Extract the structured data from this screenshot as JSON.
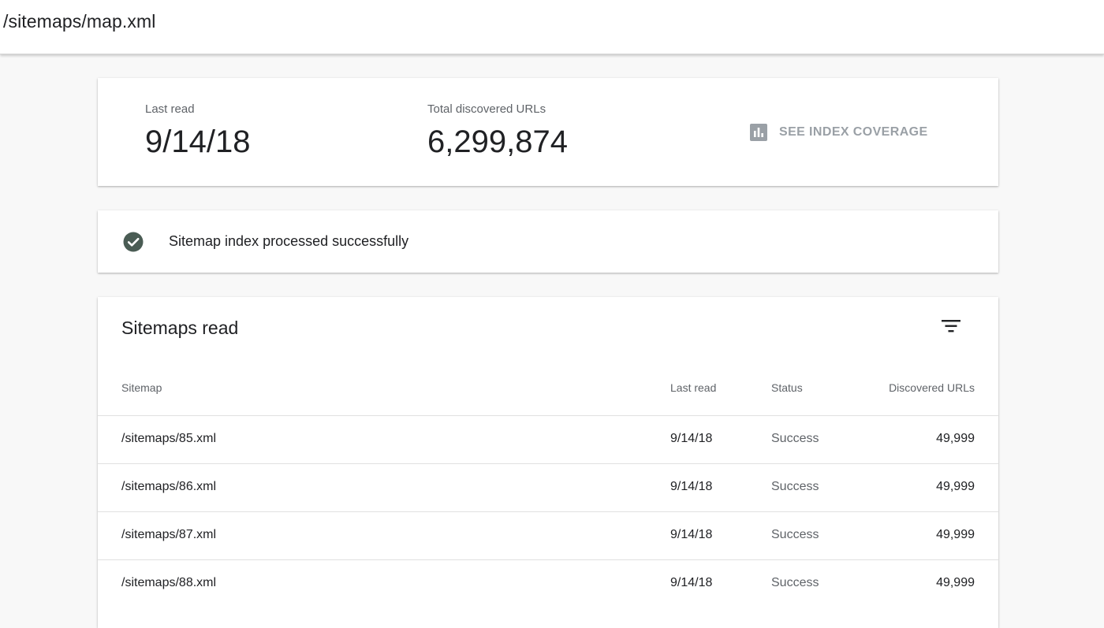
{
  "header": {
    "title": "/sitemaps/map.xml"
  },
  "summary": {
    "last_read_label": "Last read",
    "last_read_value": "9/14/18",
    "total_urls_label": "Total discovered URLs",
    "total_urls_value": "6,299,874",
    "see_coverage_label": "SEE INDEX COVERAGE",
    "see_coverage_icon": "bar-chart-icon"
  },
  "status": {
    "icon": "check-circle-icon",
    "message": "Sitemap index processed successfully",
    "icon_color": "#4a5c54"
  },
  "table": {
    "title": "Sitemaps read",
    "filter_icon": "filter-icon",
    "columns": {
      "sitemap": "Sitemap",
      "last_read": "Last read",
      "status": "Status",
      "discovered": "Discovered URLs"
    },
    "rows": [
      {
        "sitemap": "/sitemaps/85.xml",
        "last_read": "9/14/18",
        "status": "Success",
        "discovered": "49,999"
      },
      {
        "sitemap": "/sitemaps/86.xml",
        "last_read": "9/14/18",
        "status": "Success",
        "discovered": "49,999"
      },
      {
        "sitemap": "/sitemaps/87.xml",
        "last_read": "9/14/18",
        "status": "Success",
        "discovered": "49,999"
      },
      {
        "sitemap": "/sitemaps/88.xml",
        "last_read": "9/14/18",
        "status": "Success",
        "discovered": "49,999"
      }
    ]
  }
}
